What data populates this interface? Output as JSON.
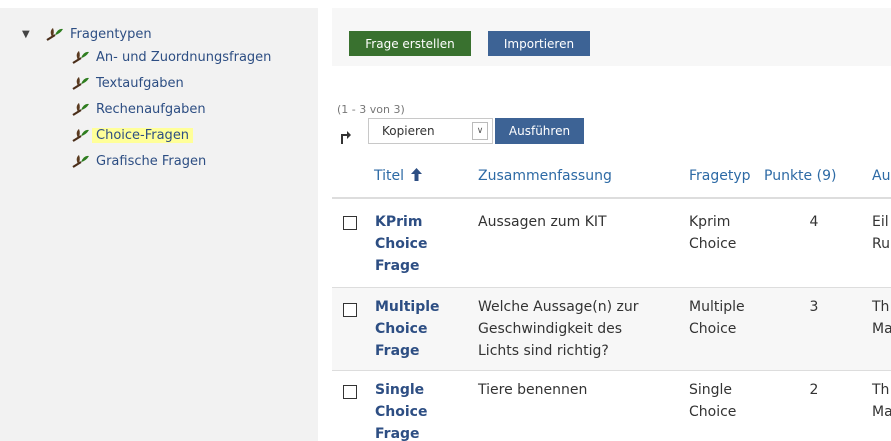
{
  "tree": {
    "root_label": "Fragentypen",
    "children": [
      {
        "label": "An- und Zuordnungsfragen"
      },
      {
        "label": "Textaufgaben"
      },
      {
        "label": "Rechenaufgaben"
      },
      {
        "label": "Choice-Fragen"
      },
      {
        "label": "Grafische Fragen"
      }
    ]
  },
  "toolbar": {
    "create_label": "Frage erstellen",
    "import_label": "Importieren"
  },
  "list": {
    "count_text": "(1 - 3 von 3)",
    "action_select_value": "Kopieren",
    "execute_label": "Ausführen"
  },
  "table": {
    "headers": {
      "title": "Titel",
      "summary": "Zusammenfassung",
      "type": "Fragetyp",
      "points": "Punkte (9)",
      "author": "Au"
    },
    "rows": [
      {
        "title": [
          "KPrim",
          "Choice",
          "Frage"
        ],
        "summary": [
          "Aussagen zum KIT"
        ],
        "type": [
          "Kprim",
          "Choice"
        ],
        "points": "4",
        "author": [
          "Eil",
          "Ru"
        ]
      },
      {
        "title": [
          "Multiple",
          "Choice",
          "Frage"
        ],
        "summary": [
          "Welche Aussage(n) zur",
          "Geschwindigkeit des",
          "Lichts sind richtig?"
        ],
        "type": [
          "Multiple",
          "Choice"
        ],
        "points": "3",
        "author": [
          "Th",
          "Ma"
        ]
      },
      {
        "title": [
          "Single",
          "Choice",
          "Frage"
        ],
        "summary": [
          "Tiere benennen"
        ],
        "type": [
          "Single",
          "Choice"
        ],
        "points": "2",
        "author": [
          "Th",
          "Ma"
        ]
      }
    ]
  },
  "colors": {
    "create_button": "#39712f",
    "primary_button": "#3d6395",
    "link": "#2d6aa5",
    "highlight": "#ffff99"
  },
  "icons": {
    "tree_node": "leaf-icon",
    "sort": "sort-up-icon",
    "action_arrow": "turn-arrow-icon"
  }
}
